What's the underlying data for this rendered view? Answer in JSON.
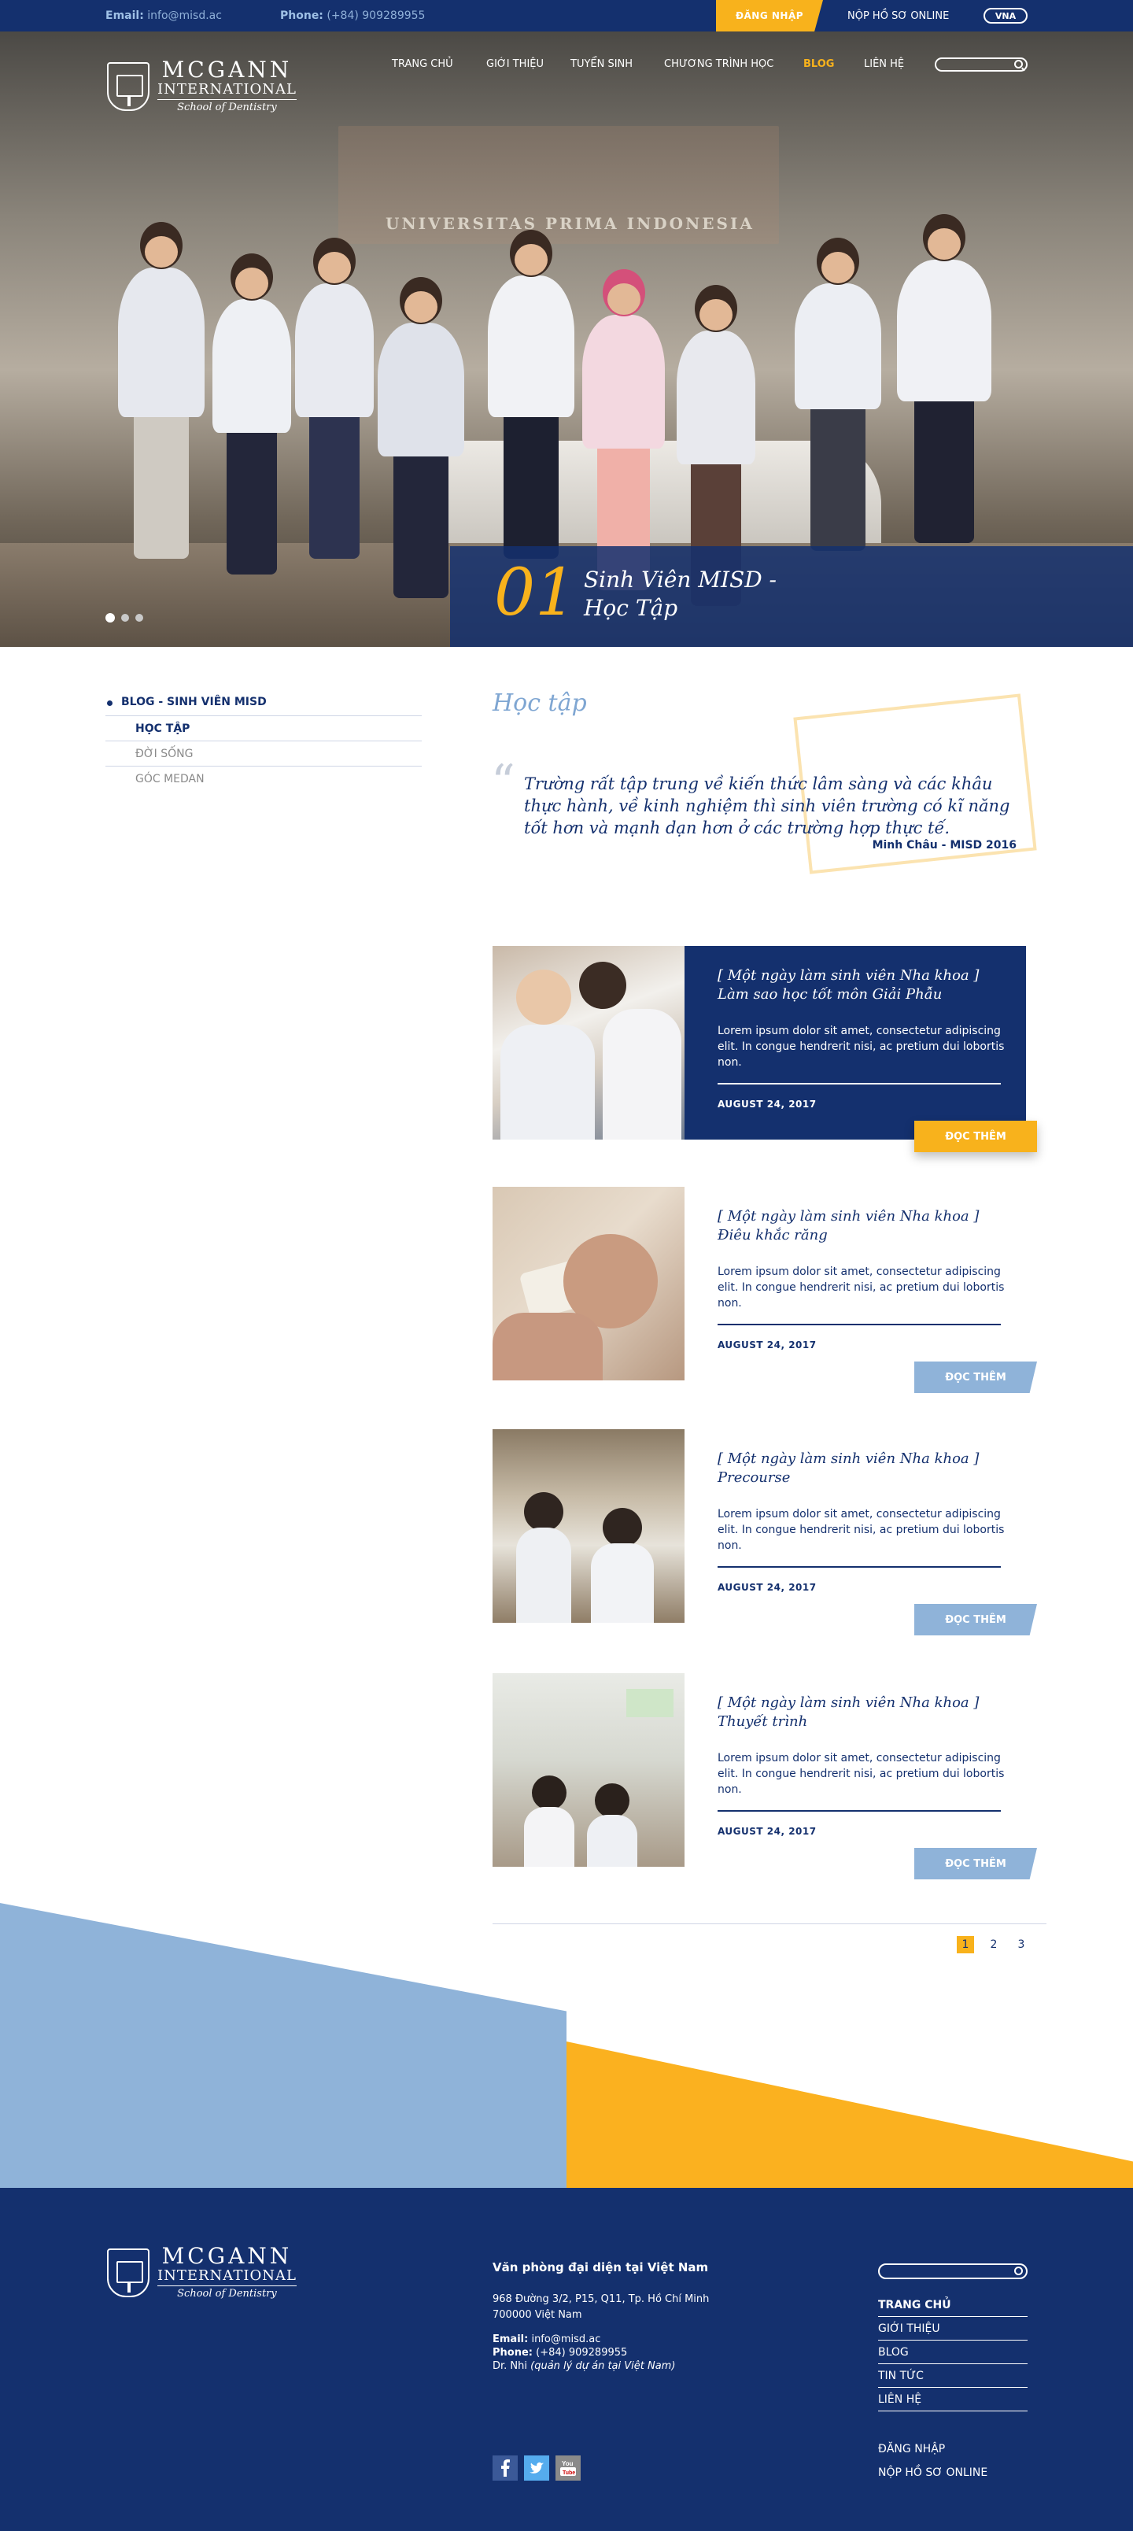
{
  "topbar": {
    "email_label": "Email:",
    "email_value": "info@misd.ac",
    "phone_label": "Phone:",
    "phone_value": "(+84) 909289955",
    "login": "ĐĂNG NHẬP",
    "apply": "NỘP HỒ SƠ ONLINE",
    "lang": "VNA"
  },
  "logo": {
    "line1": "MCGANN",
    "line2": "INTERNATIONAL",
    "line3": "School of Dentistry"
  },
  "nav": {
    "items": [
      {
        "label": "TRANG CHỦ"
      },
      {
        "label": "GIỚI THIỆU"
      },
      {
        "label": "TUYỂN SINH"
      },
      {
        "label": "CHƯƠNG TRÌNH HỌC"
      },
      {
        "label": "BLOG"
      },
      {
        "label": "LIÊN HỆ"
      }
    ],
    "active": "BLOG"
  },
  "hero": {
    "sign": "UNIVERSITAS PRIMA INDONESIA",
    "number": "01",
    "title_line1": "Sinh Viên MISD -",
    "title_line2": "Học Tập",
    "slides": 3,
    "active_slide": 1
  },
  "sidebar": {
    "category": "BLOG - SINH VIÊN MISD",
    "items": [
      {
        "label": "HỌC TẬP"
      },
      {
        "label": "ĐỜI SỐNG"
      },
      {
        "label": "GÓC MEDAN"
      }
    ]
  },
  "main": {
    "title": "Học tập",
    "quote": "Trường rất tập trung về kiến thức lâm sàng và các khâu thực hành, về kinh nghiệm thì sinh viên trường có kĩ năng tốt hơn và mạnh dạn hơn ở các trường hợp thực tế.",
    "quote_author": "Minh Châu - MISD 2016",
    "posts": [
      {
        "title_line1": "[ Một ngày làm sinh viên Nha khoa ]",
        "title_line2": "Làm sao học tốt môn Giải Phẫu",
        "excerpt": "Lorem ipsum dolor sit amet, consectetur adipiscing elit. In congue hendrerit nisi, ac pretium dui lobortis non.",
        "date": "AUGUST 24, 2017",
        "read_more": "ĐỌC THÊM"
      },
      {
        "title_line1": "[ Một ngày làm sinh viên Nha khoa ]",
        "title_line2": "Điêu khắc răng",
        "excerpt": "Lorem ipsum dolor sit amet, consectetur adipiscing elit. In congue hendrerit nisi, ac pretium dui lobortis non.",
        "date": "AUGUST 24, 2017",
        "read_more": "ĐỌC THÊM"
      },
      {
        "title_line1": "[ Một ngày làm sinh viên Nha khoa ]",
        "title_line2": "Precourse",
        "excerpt": "Lorem ipsum dolor sit amet, consectetur adipiscing elit. In congue hendrerit nisi, ac pretium dui lobortis non.",
        "date": "AUGUST 24, 2017",
        "read_more": "ĐỌC THÊM"
      },
      {
        "title_line1": "[ Một ngày làm sinh viên Nha khoa ]",
        "title_line2": "Thuyết trình",
        "excerpt": "Lorem ipsum dolor sit amet, consectetur adipiscing elit. In congue hendrerit nisi, ac pretium dui lobortis non.",
        "date": "AUGUST 24, 2017",
        "read_more": "ĐỌC THÊM"
      }
    ],
    "pagination": [
      "1",
      "2",
      "3"
    ],
    "current_page": "1"
  },
  "footer": {
    "office_title": "Văn phòng đại diện tại Việt Nam",
    "address_line1": "968 Đường 3/2, P15, Q11, Tp. Hồ Chí Minh",
    "address_line2": "700000 Việt Nam",
    "email_label": "Email:",
    "email_value": "info@misd.ac",
    "phone_label": "Phone:",
    "phone_value": "(+84) 909289955",
    "manager": "Dr. Nhi",
    "manager_note": "(quản lý dự án tại Việt Nam)",
    "nav": [
      {
        "label": "TRANG CHỦ"
      },
      {
        "label": "GIỚI THIỆU"
      },
      {
        "label": "BLOG"
      },
      {
        "label": "TIN TỨC"
      },
      {
        "label": "LIÊN HỆ"
      }
    ],
    "login": "ĐĂNG NHẬP",
    "apply": "NỘP HỒ SƠ ONLINE",
    "social": [
      "facebook-icon",
      "twitter-icon",
      "youtube-icon"
    ]
  },
  "colors": {
    "navy": "#14306e",
    "yellow": "#f8b21c",
    "light_blue": "#8fb3d9"
  }
}
